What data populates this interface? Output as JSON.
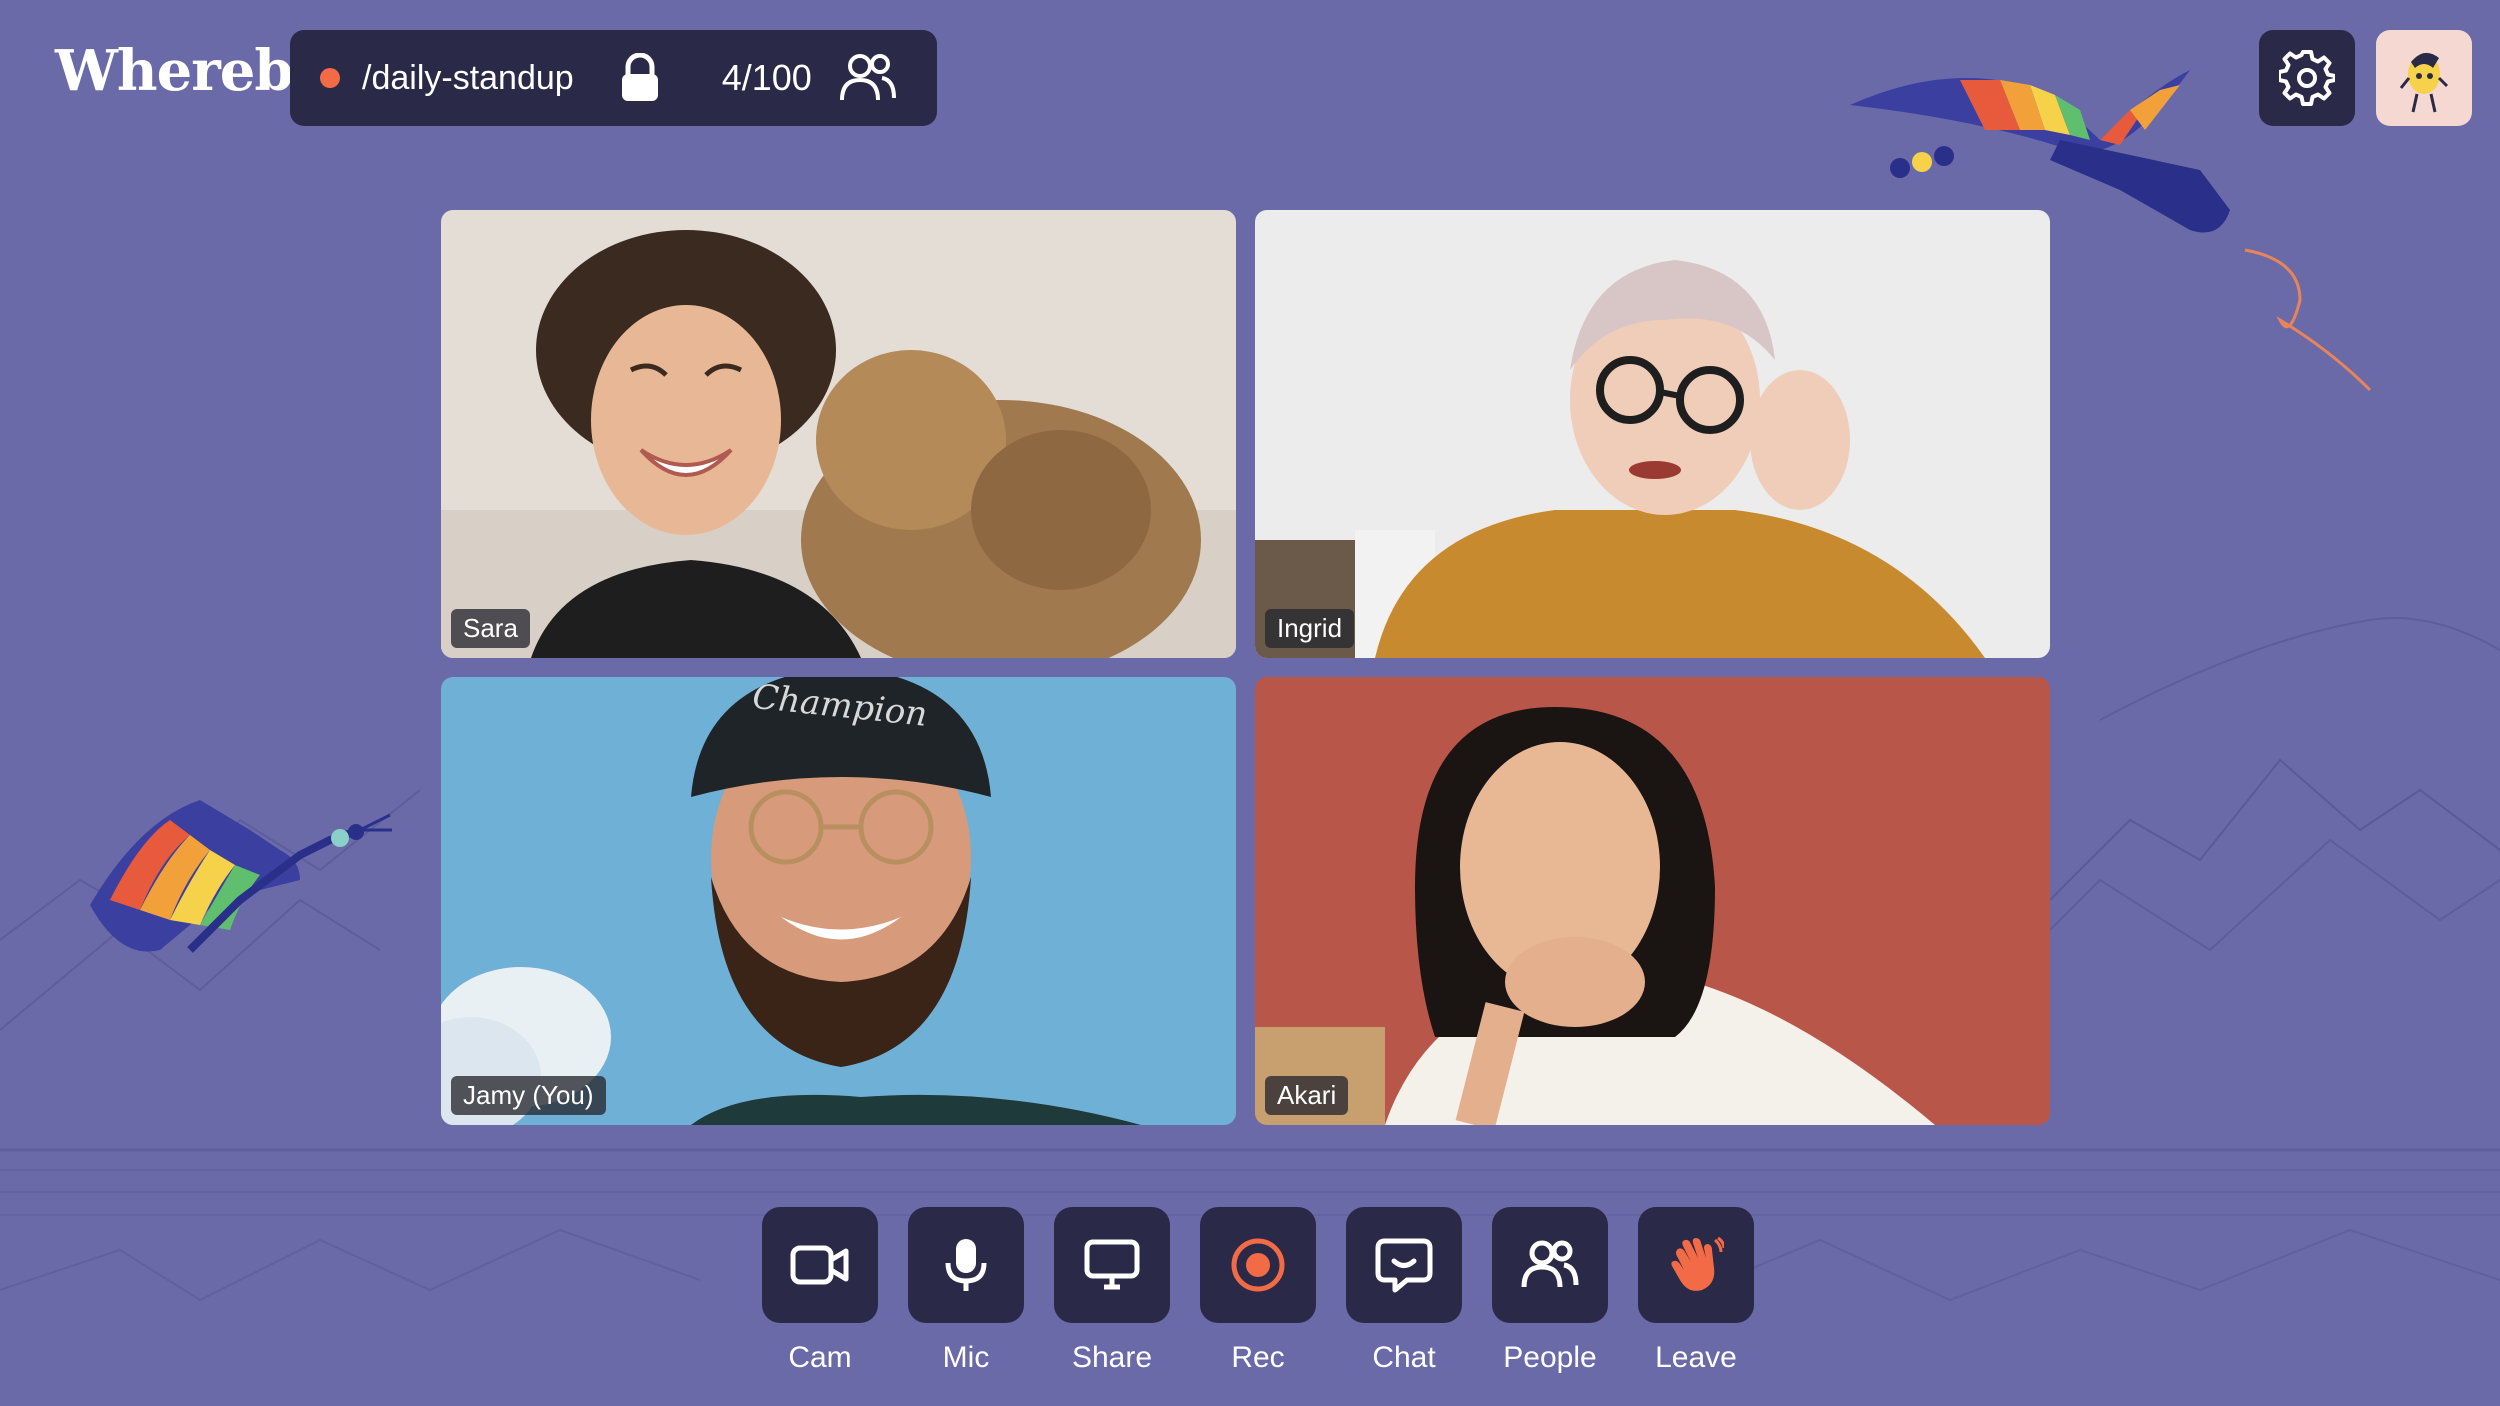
{
  "app": {
    "logo_text": "Whereby"
  },
  "header": {
    "room_name": "/daily-standup",
    "participant_count": "4/100",
    "recording_indicator_color": "#f26b46"
  },
  "participants": [
    {
      "name": "Sara"
    },
    {
      "name": "Ingrid"
    },
    {
      "name": "Jamy (You)"
    },
    {
      "name": "Akari"
    }
  ],
  "toolbar": {
    "cam_label": "Cam",
    "mic_label": "Mic",
    "share_label": "Share",
    "rec_label": "Rec",
    "chat_label": "Chat",
    "people_label": "People",
    "leave_label": "Leave"
  },
  "icons": {
    "settings": "gear-icon",
    "lock": "lock-icon",
    "people": "people-icon",
    "cam": "video-camera-icon",
    "mic": "microphone-icon",
    "share": "monitor-icon",
    "rec": "record-icon",
    "chat": "chat-bubble-icon",
    "leave": "waving-hand-icon"
  },
  "colors": {
    "background": "#6b6aa8",
    "button_bg": "#2a2a48",
    "accent_orange": "#f26b46",
    "avatar_bg": "#f6d8d2"
  }
}
